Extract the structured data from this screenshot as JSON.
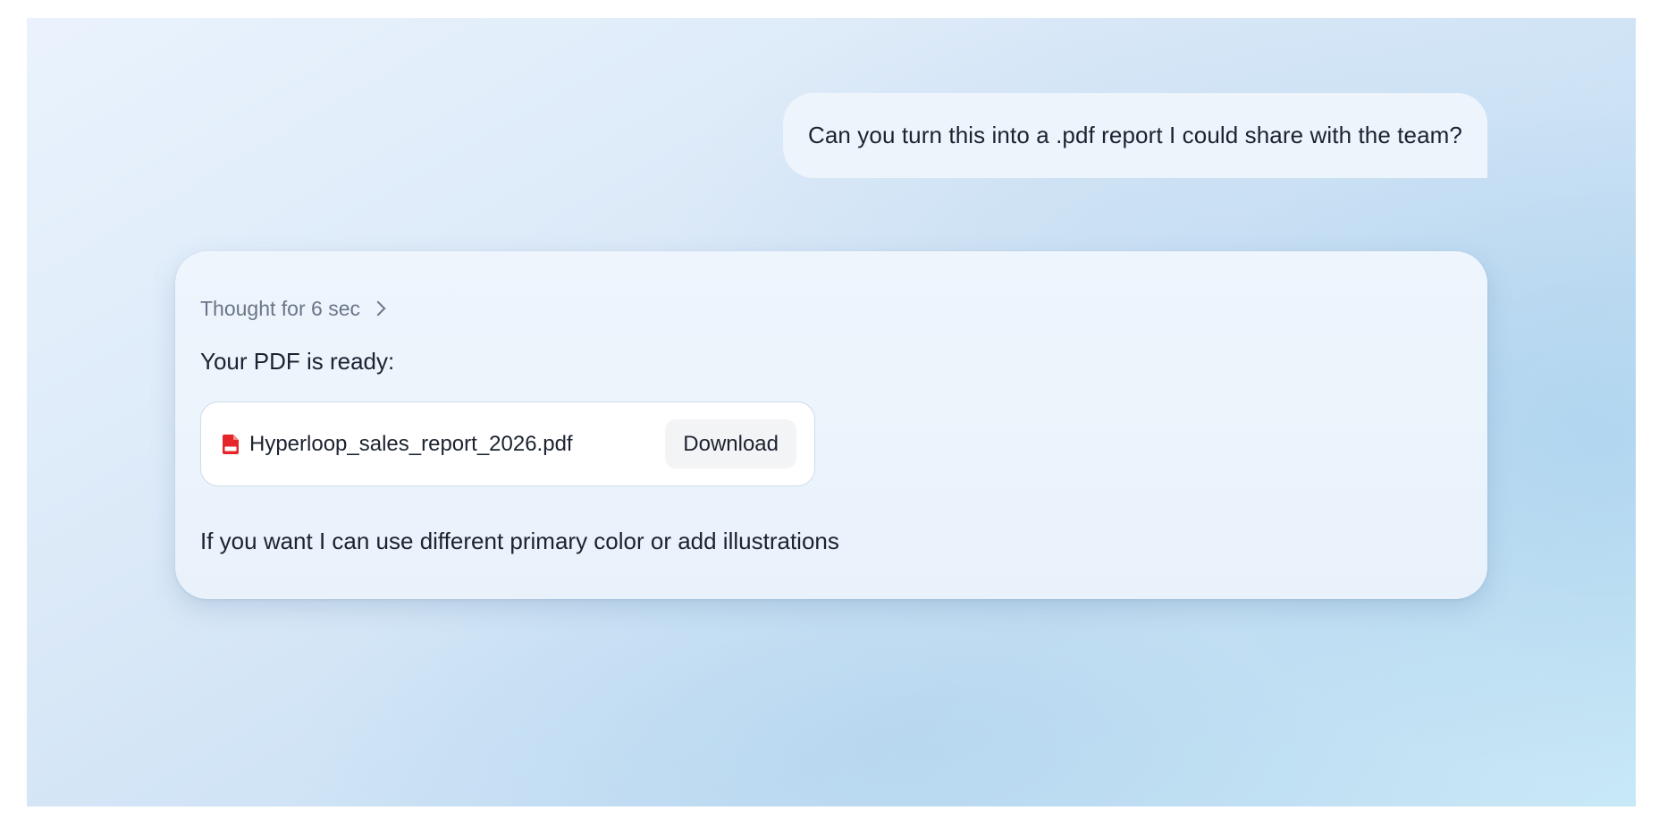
{
  "conversation": {
    "user_message": "Can you turn this into a .pdf report I could share with the team?",
    "assistant": {
      "thought_label": "Thought for 6 sec",
      "ready_text": "Your PDF is ready:",
      "attachment": {
        "file_name": "Hyperloop_sales_report_2026.pdf",
        "icon": "pdf-file-icon",
        "icon_color": "#e5252a",
        "download_label": "Download"
      },
      "followup_text": "If you want I can use different primary color or add illustrations"
    }
  }
}
